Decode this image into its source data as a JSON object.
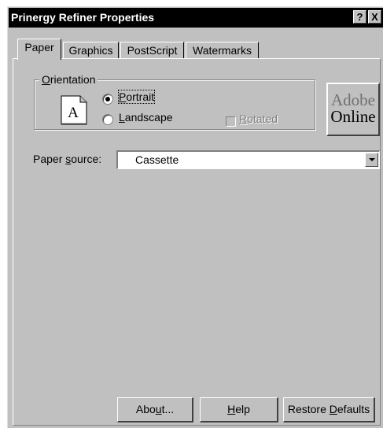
{
  "window": {
    "title": "Prinergy Refiner Properties",
    "help_button": "?",
    "close_button": "X"
  },
  "tabs": [
    {
      "label": "Paper",
      "active": true
    },
    {
      "label": "Graphics",
      "active": false
    },
    {
      "label": "PostScript",
      "active": false
    },
    {
      "label": "Watermarks",
      "active": false
    }
  ],
  "orientation": {
    "group_label_mnemonic": "O",
    "group_label_rest": "rientation",
    "preview_letter": "A",
    "options": [
      {
        "mnemonic": "P",
        "rest": "ortrait",
        "selected": true
      },
      {
        "mnemonic": "L",
        "rest": "andscape",
        "selected": false
      }
    ],
    "rotated": {
      "mnemonic": "R",
      "rest": "otated",
      "checked": false,
      "enabled": false
    }
  },
  "adobe_online": {
    "line1": "Adobe",
    "line2": "Online"
  },
  "paper_source": {
    "label_before": "Paper ",
    "label_mnemonic": "s",
    "label_after": "ource:",
    "value": "Cassette"
  },
  "buttons": {
    "about": {
      "before": "Abo",
      "mnemonic": "u",
      "after": "t..."
    },
    "help": {
      "before": "",
      "mnemonic": "H",
      "after": "elp"
    },
    "restore": {
      "before": "Restore ",
      "mnemonic": "D",
      "after": "efaults"
    }
  },
  "icons": {
    "document": "document-portrait-icon",
    "dropdown": "chevron-down-icon"
  }
}
